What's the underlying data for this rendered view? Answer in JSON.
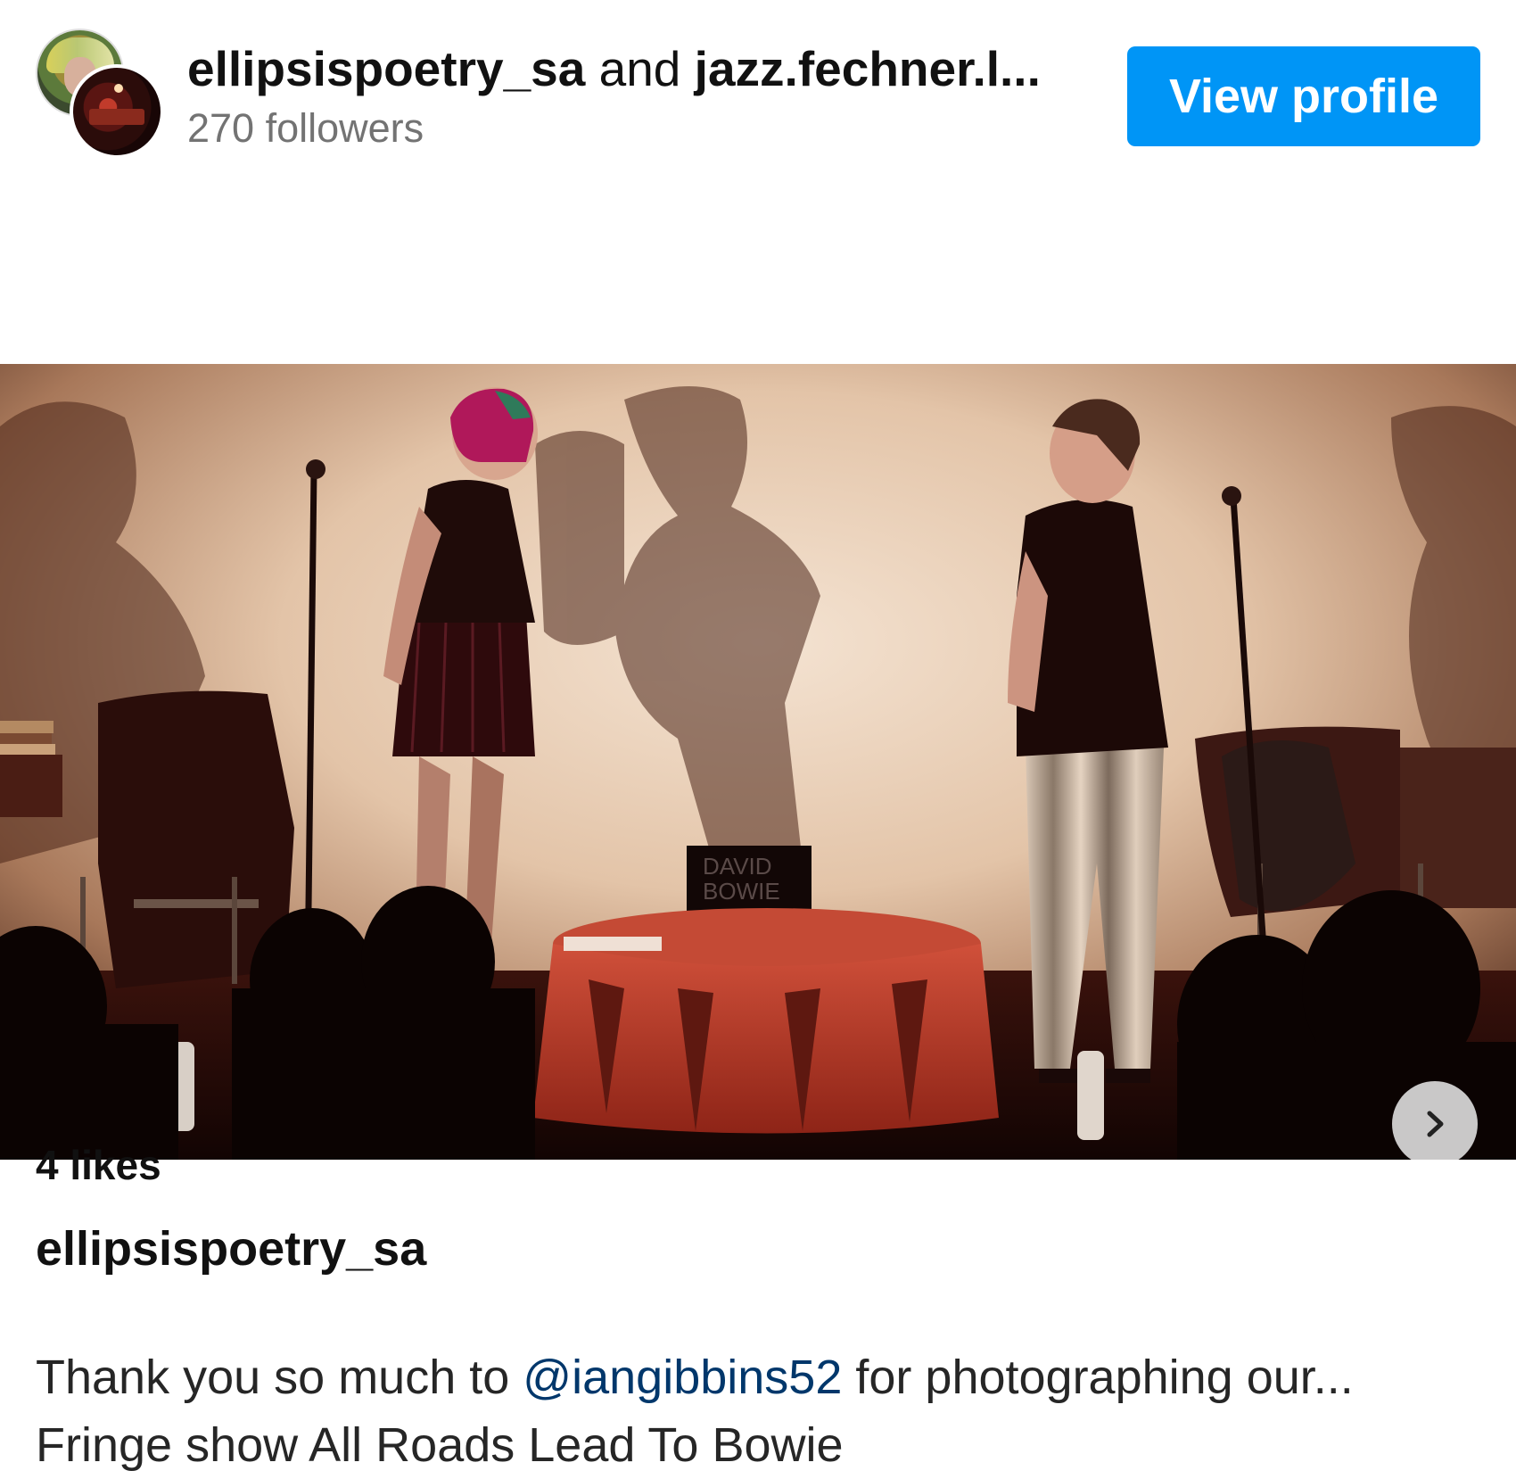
{
  "header": {
    "author_primary": "ellipsispoetry_sa",
    "joiner": "and",
    "author_secondary": "jazz.fechner.l...",
    "followers": "270 followers",
    "view_profile_label": "View profile"
  },
  "post": {
    "likes": "4 likes",
    "caption_username": "ellipsispoetry_sa",
    "caption_prefix": "Thank you so much to",
    "caption_mention": "@iangibbins52",
    "caption_suffix": "for photographing our...",
    "caption_line2": "Fringe show All Roads Lead To Bowie",
    "photo_box_text_line1": "DAVID",
    "photo_box_text_line2": "BOWIE"
  },
  "icons": {
    "next": "chevron-right-icon"
  },
  "colors": {
    "accent": "#0095f6",
    "mention": "#00376b",
    "secondary_text": "#737373"
  }
}
